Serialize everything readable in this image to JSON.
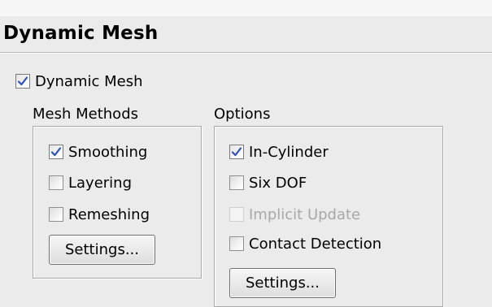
{
  "panel": {
    "title": "Dynamic Mesh"
  },
  "dynamic_mesh": {
    "label": "Dynamic Mesh",
    "checked": true
  },
  "mesh_methods": {
    "title": "Mesh Methods",
    "items": [
      {
        "label": "Smoothing",
        "checked": true,
        "enabled": true
      },
      {
        "label": "Layering",
        "checked": false,
        "enabled": true
      },
      {
        "label": "Remeshing",
        "checked": false,
        "enabled": true
      }
    ],
    "settings_label": "Settings..."
  },
  "options": {
    "title": "Options",
    "items": [
      {
        "label": "In-Cylinder",
        "checked": true,
        "enabled": true
      },
      {
        "label": "Six DOF",
        "checked": false,
        "enabled": true
      },
      {
        "label": "Implicit Update",
        "checked": false,
        "enabled": false
      },
      {
        "label": "Contact Detection",
        "checked": false,
        "enabled": true
      }
    ],
    "settings_label": "Settings..."
  },
  "colors": {
    "background": "#ebebeb",
    "checkmark": "#2c4fb8",
    "disabled_text": "#a8a8a8"
  }
}
